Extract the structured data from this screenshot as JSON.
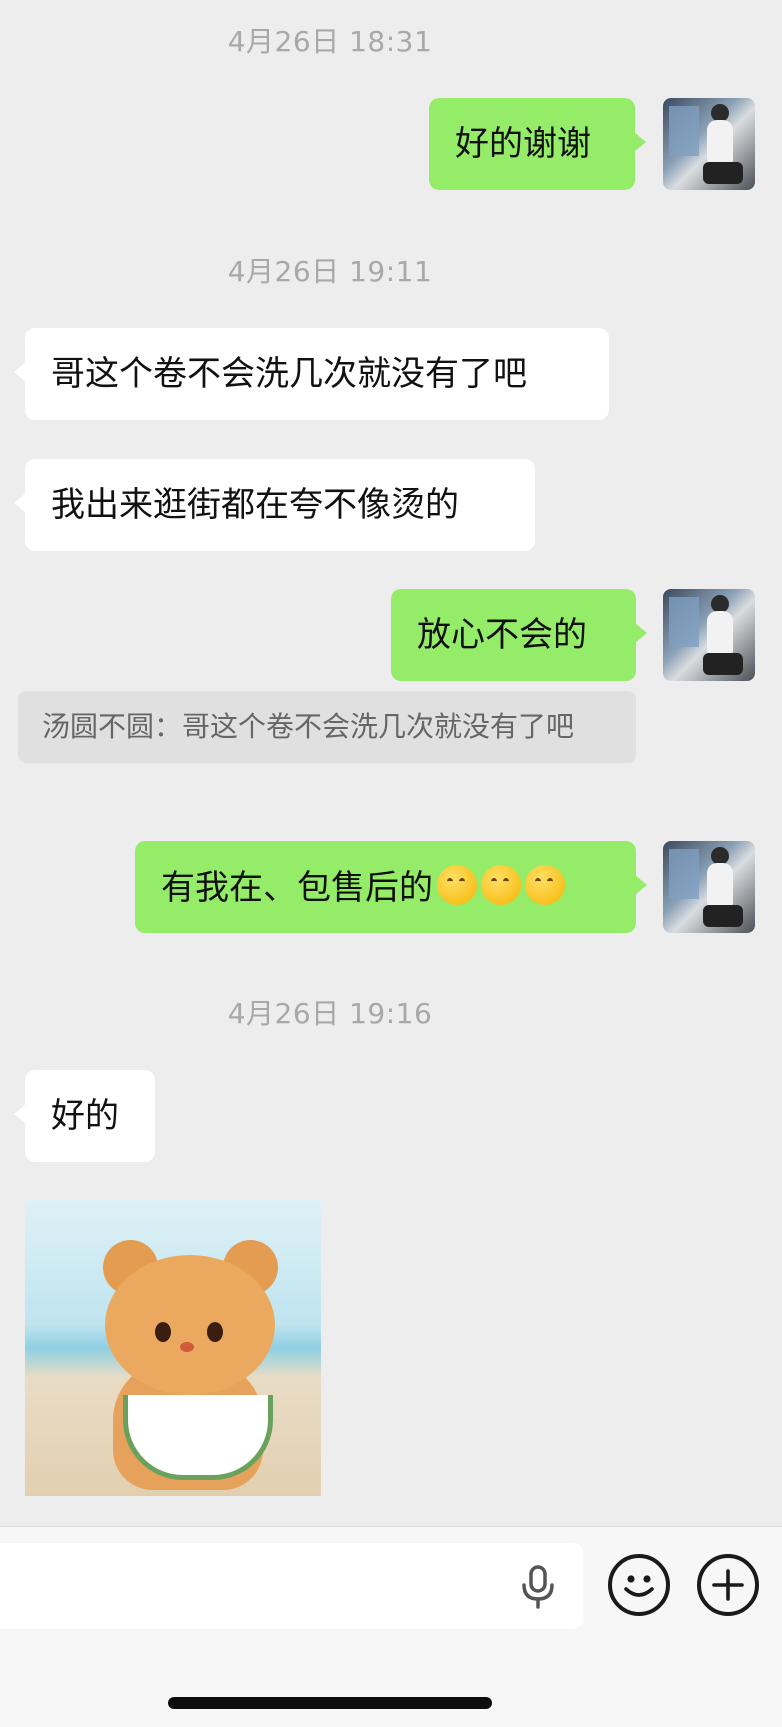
{
  "timestamps": [
    "4月26日 18:31",
    "4月26日 19:11",
    "4月26日 19:16"
  ],
  "messages": {
    "m1": "好的谢谢",
    "m2": "哥这个卷不会洗几次就没有了吧",
    "m3": "我出来逛街都在夸不像烫的",
    "m4": "放心不会的",
    "quote": "汤圆不圆：哥这个卷不会洗几次就没有了吧",
    "m5": "有我在、包售后的",
    "m6": "好的"
  },
  "icons": {
    "mic": "microphone-icon",
    "emoji": "smiley-icon",
    "plus": "plus-icon",
    "reaction": "thinking-face-emoji"
  },
  "colors": {
    "background": "#ededed",
    "outgoing_bubble": "#95ec69",
    "incoming_bubble": "#ffffff",
    "timestamp": "#a8a8a8"
  }
}
